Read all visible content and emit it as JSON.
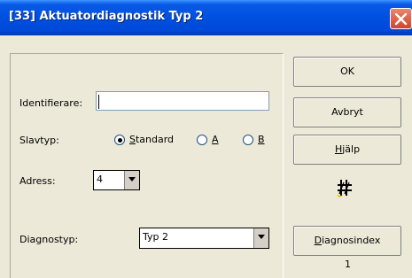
{
  "window": {
    "title": "[33] Aktuatordiagnostik Typ 2",
    "close_icon": "close-icon"
  },
  "form": {
    "identifier_label": "Identifierare:",
    "identifier_value": "",
    "slavtyp_label": "Slavtyp:",
    "radio_standard_mnemonic": "S",
    "radio_standard_rest": "tandard",
    "radio_a": "A",
    "radio_b": "B",
    "slavtyp_selected": "Standard",
    "adress_label": "Adress:",
    "adress_value": "4",
    "diagnostyp_label": "Diagnostyp:",
    "diagnostyp_value": "Typ 2"
  },
  "buttons": {
    "ok": "OK",
    "cancel": "Avbryt",
    "help_mnemonic": "H",
    "help_rest": "jälp",
    "diag_index_mnemonic": "D",
    "diag_index_rest": "iagnosindex",
    "diag_index_value": "1"
  },
  "icons": {
    "diagnostics": "diagnostics-tool-icon"
  }
}
